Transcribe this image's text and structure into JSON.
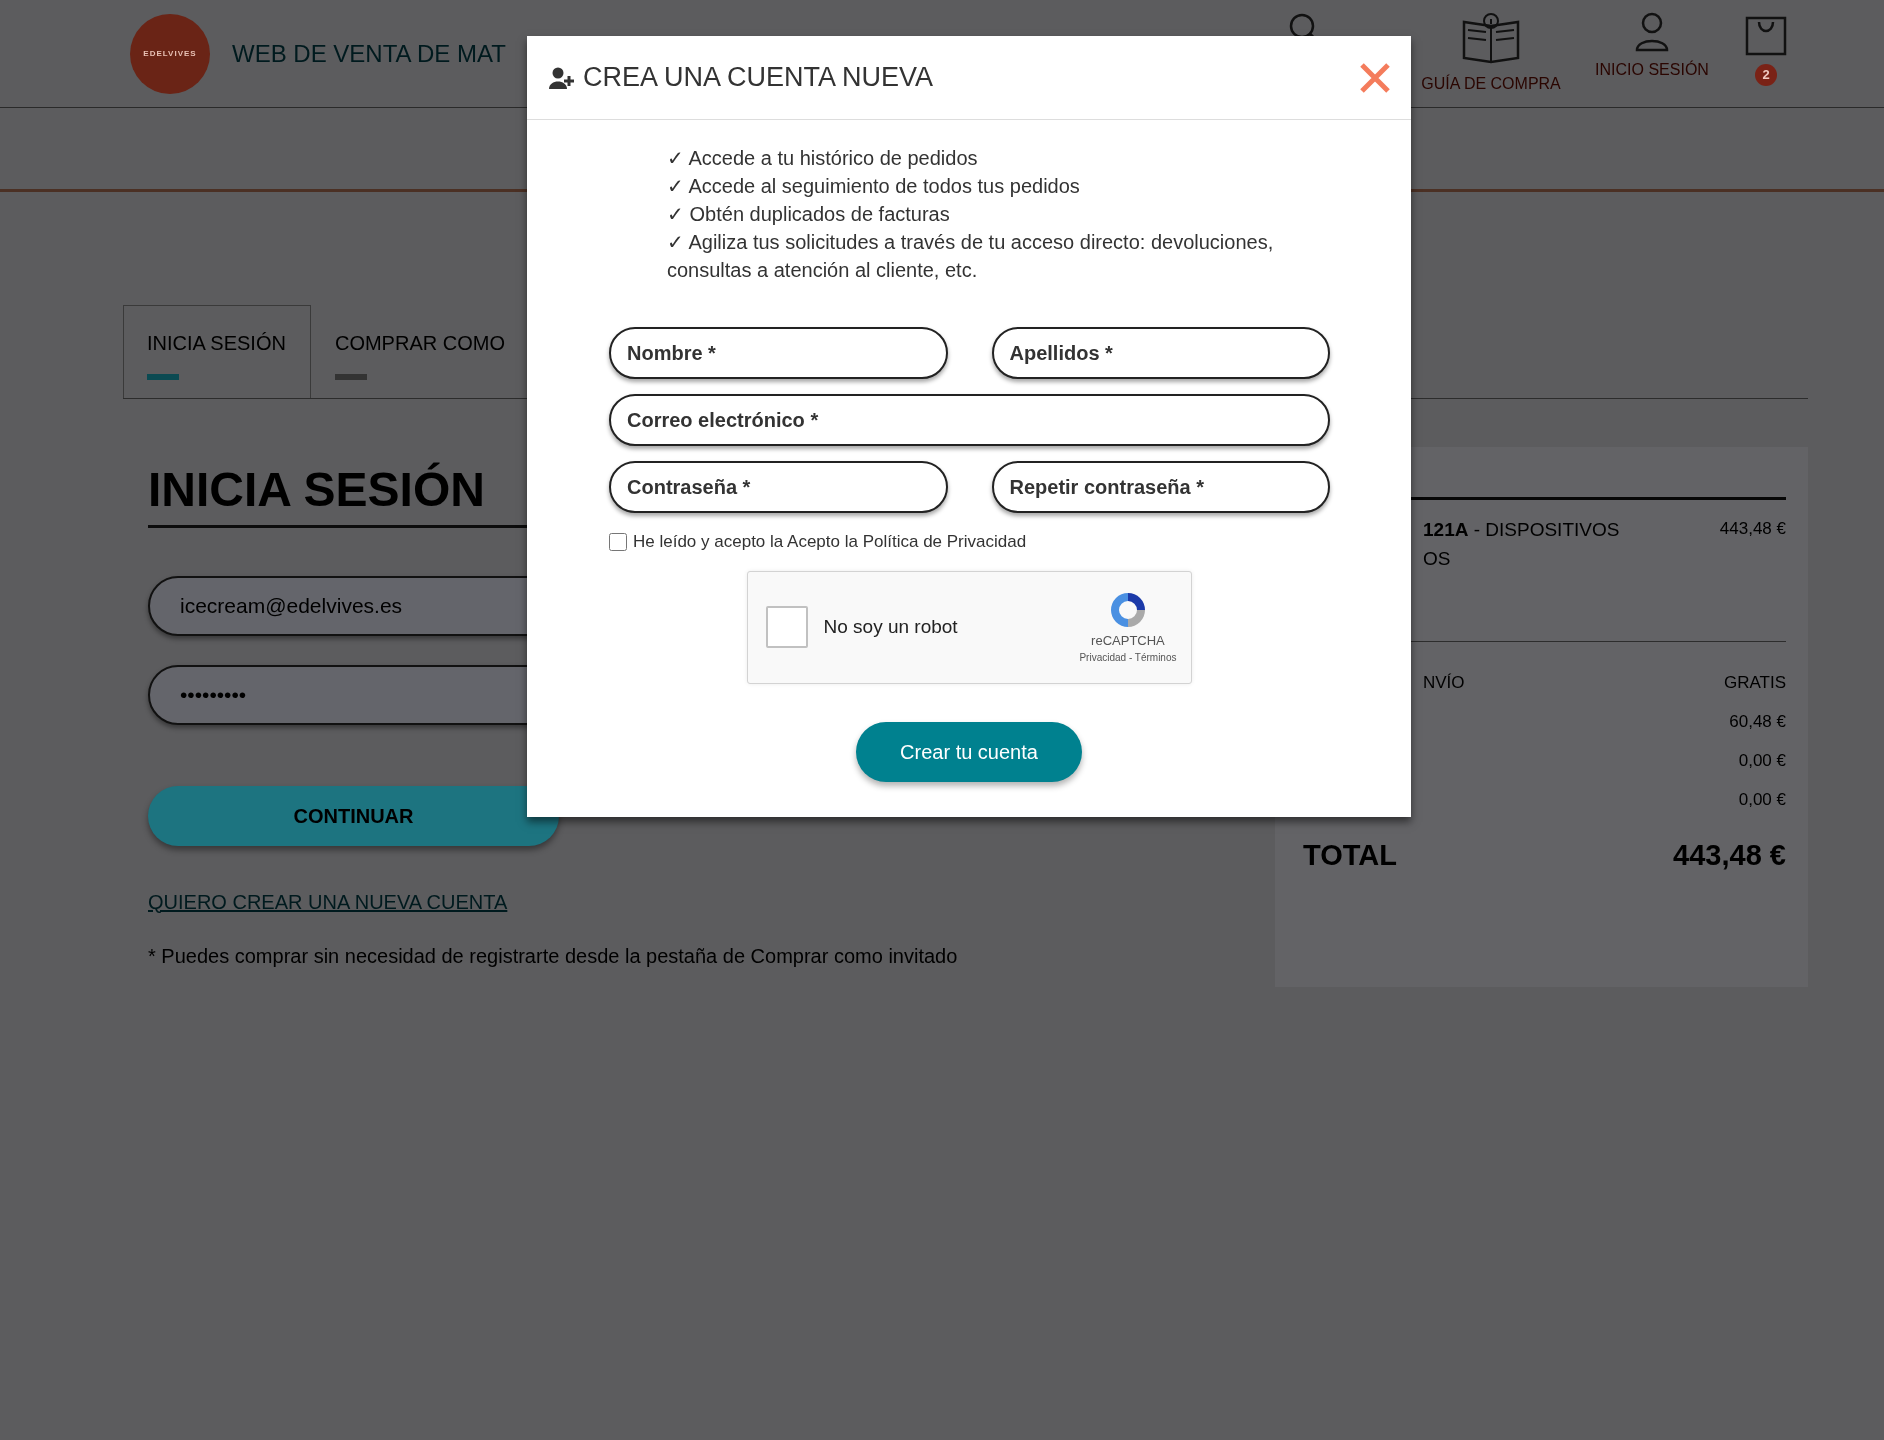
{
  "header": {
    "logo_text": "EDELVIVES",
    "site_title": "WEB DE VENTA DE MAT",
    "nav": [
      {
        "kind": "search"
      },
      {
        "kind": "guide",
        "label": "GUÍA DE COMPRA"
      },
      {
        "kind": "user",
        "label": "INICIO SESIÓN"
      },
      {
        "kind": "cart",
        "badge": "2"
      }
    ]
  },
  "tabs": [
    {
      "label": "INICIA SESIÓN",
      "selected": true
    },
    {
      "label": "COMPRAR COMO",
      "selected": false
    }
  ],
  "login": {
    "heading": "INICIA SESIÓN",
    "email": "icecream@edelvives.es",
    "password": "•••••••••",
    "button": "CONTINUAR",
    "create_link": "QUIERO CREAR UNA NUEVA CUENTA",
    "note": "* Puedes comprar sin necesidad de registrarte desde la pestaña de",
    "note_link": "Comprar como invitado"
  },
  "summary": {
    "items": [
      {
        "code": "121A",
        "description": "- DISPOSITIVOS",
        "description_line_2": "OS",
        "price": "443,48 €"
      }
    ],
    "rows": [
      {
        "label": "NVÍO",
        "value": "GRATIS"
      },
      {
        "value": "60,48 €"
      },
      {
        "value": "0,00 €"
      },
      {
        "value": "0,00 €"
      }
    ],
    "total": {
      "label": "TOTAL",
      "value": "443,48 €"
    }
  },
  "modal": {
    "title": "CREA UNA CUENTA NUEVA",
    "benefits": [
      "✓ Accede a tu histórico de pedidos",
      "✓ Accede al seguimiento de todos tus pedidos",
      "✓ Obtén duplicados de facturas",
      "✓ Agiliza tus solicitudes a través de tu acceso directo: devoluciones, consultas a atención al cliente, etc."
    ],
    "field_rows": [
      [
        {
          "placeholder": "Nombre *"
        },
        {
          "placeholder": "Apellidos *"
        }
      ],
      [
        {
          "placeholder": "Correo electrónico *"
        }
      ],
      [
        {
          "placeholder": "Contraseña *"
        },
        {
          "placeholder": "Repetir contraseña *"
        }
      ]
    ],
    "privacy": {
      "checked": false,
      "text": "He leído y acepto la Acepto la",
      "link": "Política de Privacidad"
    },
    "captcha": {
      "checked": false,
      "label": "No soy un robot",
      "brand": "reCAPTCHA",
      "links": "Privacidad - Términos"
    },
    "submit": "Crear tu cuenta"
  }
}
